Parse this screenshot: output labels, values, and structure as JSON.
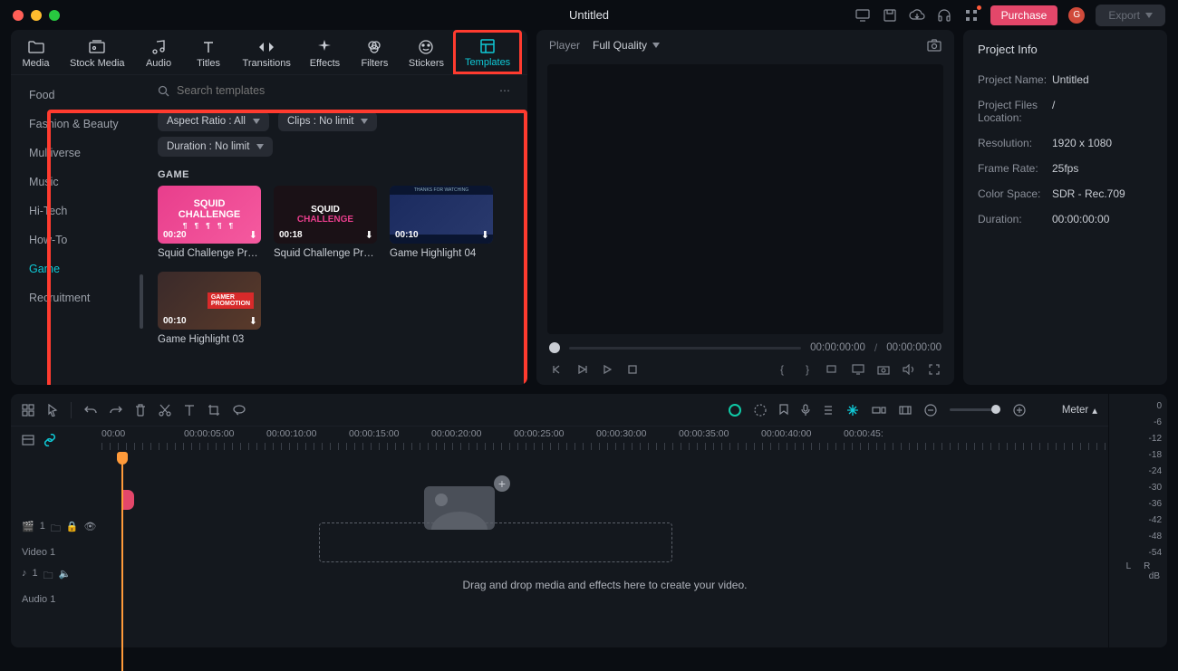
{
  "window": {
    "title": "Untitled"
  },
  "titlebar": {
    "purchase": "Purchase",
    "avatar": "G",
    "export": "Export"
  },
  "tabs": [
    {
      "label": "Media"
    },
    {
      "label": "Stock Media"
    },
    {
      "label": "Audio"
    },
    {
      "label": "Titles"
    },
    {
      "label": "Transitions"
    },
    {
      "label": "Effects"
    },
    {
      "label": "Filters"
    },
    {
      "label": "Stickers"
    },
    {
      "label": "Templates"
    }
  ],
  "search": {
    "placeholder": "Search templates"
  },
  "filters": {
    "aspect": "Aspect Ratio : All",
    "clips": "Clips : No limit",
    "duration": "Duration : No limit"
  },
  "categories": [
    {
      "label": "Food"
    },
    {
      "label": "Fashion & Beauty"
    },
    {
      "label": "Multiverse"
    },
    {
      "label": "Music"
    },
    {
      "label": "Hi-Tech"
    },
    {
      "label": "How-To"
    },
    {
      "label": "Game",
      "active": true
    },
    {
      "label": "Recruitment"
    }
  ],
  "section_title": "GAME",
  "cards": [
    {
      "title": "Squid Challenge Pro…",
      "dur": "00:20"
    },
    {
      "title": "Squid Challenge Pro…",
      "dur": "00:18"
    },
    {
      "title": "Game Highlight 04",
      "dur": "00:10"
    },
    {
      "title": "Game Highlight 03",
      "dur": "00:10"
    }
  ],
  "thumb_texts": {
    "squid_line1": "SQUID",
    "squid_line2": "CHALLENGE",
    "thanks": "THANKS FOR WATCHING",
    "gamer1": "GAMER",
    "gamer2": "PROMOTION"
  },
  "player": {
    "label": "Player",
    "quality": "Full Quality",
    "time_current": "00:00:00:00",
    "time_total": "00:00:00:00"
  },
  "sidebar": {
    "title": "Project Info",
    "name_k": "Project Name:",
    "name_v": "Untitled",
    "loc_k": "Project Files Location:",
    "loc_v": "/",
    "res_k": "Resolution:",
    "res_v": "1920 x 1080",
    "fps_k": "Frame Rate:",
    "fps_v": "25fps",
    "cs_k": "Color Space:",
    "cs_v": "SDR - Rec.709",
    "dur_k": "Duration:",
    "dur_v": "00:00:00:00"
  },
  "timeline": {
    "meter": "Meter",
    "ruler": [
      "00:00",
      "00:00:05:00",
      "00:00:10:00",
      "00:00:15:00",
      "00:00:20:00",
      "00:00:25:00",
      "00:00:30:00",
      "00:00:35:00",
      "00:00:40:00",
      "00:00:45:"
    ],
    "video_track": "Video 1",
    "audio_track": "Audio 1",
    "drop_text": "Drag and drop media and effects here to create your video.",
    "db": [
      "0",
      "-6",
      "-12",
      "-18",
      "-24",
      "-30",
      "-36",
      "-42",
      "-48",
      "-54"
    ],
    "db_label": "dB",
    "L": "L",
    "R": "R",
    "track_badge": "1"
  }
}
